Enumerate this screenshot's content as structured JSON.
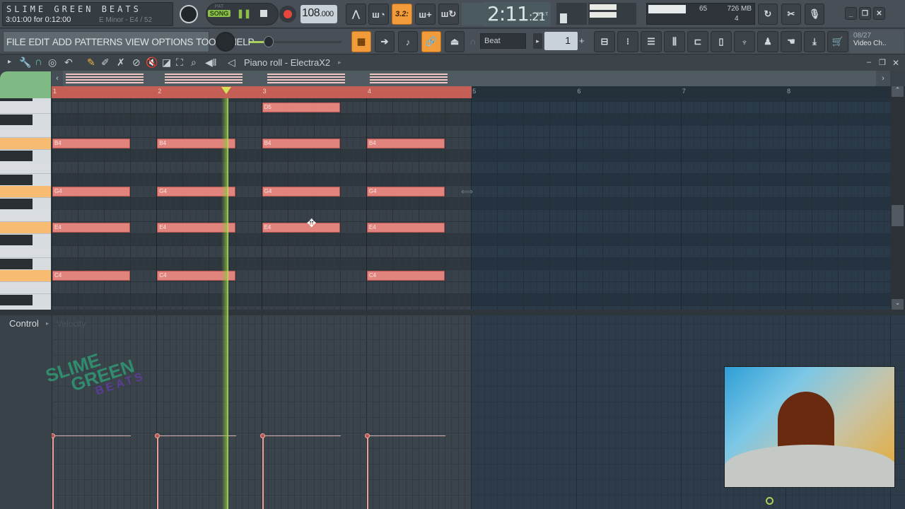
{
  "hint_bar": {
    "title": "SLIME GREEN BEATS",
    "time_info": "3:01:00 for 0:12:00",
    "scale_info": "E Minor - E4 / 52"
  },
  "transport": {
    "pat_label": "PAT",
    "song_label": "SONG",
    "tempo_int": "108",
    "tempo_dec": ".000",
    "counter_label": "3.2:"
  },
  "clock": {
    "main": "2:11",
    "sub": ":21",
    "unit": "B:S:T"
  },
  "cpu": {
    "value": "65",
    "memory": "726 MB",
    "polyphony": "4"
  },
  "menu": [
    "FILE",
    "EDIT",
    "ADD",
    "PATTERNS",
    "VIEW",
    "OPTIONS",
    "TOOLS",
    "HELP"
  ],
  "snap": {
    "value": "Beat"
  },
  "step": {
    "value": "1"
  },
  "news": {
    "date": "08/27",
    "label": "Video Ch.."
  },
  "piano_roll": {
    "title": "Piano roll - ElectraX2",
    "bars": [
      "1",
      "2",
      "3",
      "4",
      "5",
      "6",
      "7",
      "8"
    ],
    "selection_end_bar": 5,
    "playhead_bar": 2.67,
    "notes": [
      {
        "pitch": "B4",
        "bar": 1,
        "length": 0.75
      },
      {
        "pitch": "G4",
        "bar": 1,
        "length": 0.75
      },
      {
        "pitch": "E4",
        "bar": 1,
        "length": 0.75
      },
      {
        "pitch": "C4",
        "bar": 1,
        "length": 0.75
      },
      {
        "pitch": "B4",
        "bar": 2,
        "length": 0.75
      },
      {
        "pitch": "G4",
        "bar": 2,
        "length": 0.75
      },
      {
        "pitch": "E4",
        "bar": 2,
        "length": 0.75
      },
      {
        "pitch": "C4",
        "bar": 2,
        "length": 0.75
      },
      {
        "pitch": "D5",
        "bar": 3,
        "length": 0.75
      },
      {
        "pitch": "B4",
        "bar": 3,
        "length": 0.75
      },
      {
        "pitch": "G4",
        "bar": 3,
        "length": 0.75
      },
      {
        "pitch": "E4",
        "bar": 3,
        "length": 0.75
      },
      {
        "pitch": "B4",
        "bar": 4,
        "length": 0.75
      },
      {
        "pitch": "G4",
        "bar": 4,
        "length": 0.75
      },
      {
        "pitch": "E4",
        "bar": 4,
        "length": 0.75
      },
      {
        "pitch": "C4",
        "bar": 4,
        "length": 0.75
      }
    ],
    "highlighted_keys": [
      "B4",
      "G4",
      "E4",
      "C4"
    ]
  },
  "control": {
    "label": "Control",
    "param": "Velocity",
    "velocity_bars": [
      1,
      2,
      3,
      4
    ]
  },
  "watermark": {
    "line1": "SLIME",
    "line2": "GREEN",
    "line3": "BEATS"
  },
  "webcam": {
    "label": "webcam overlay"
  }
}
